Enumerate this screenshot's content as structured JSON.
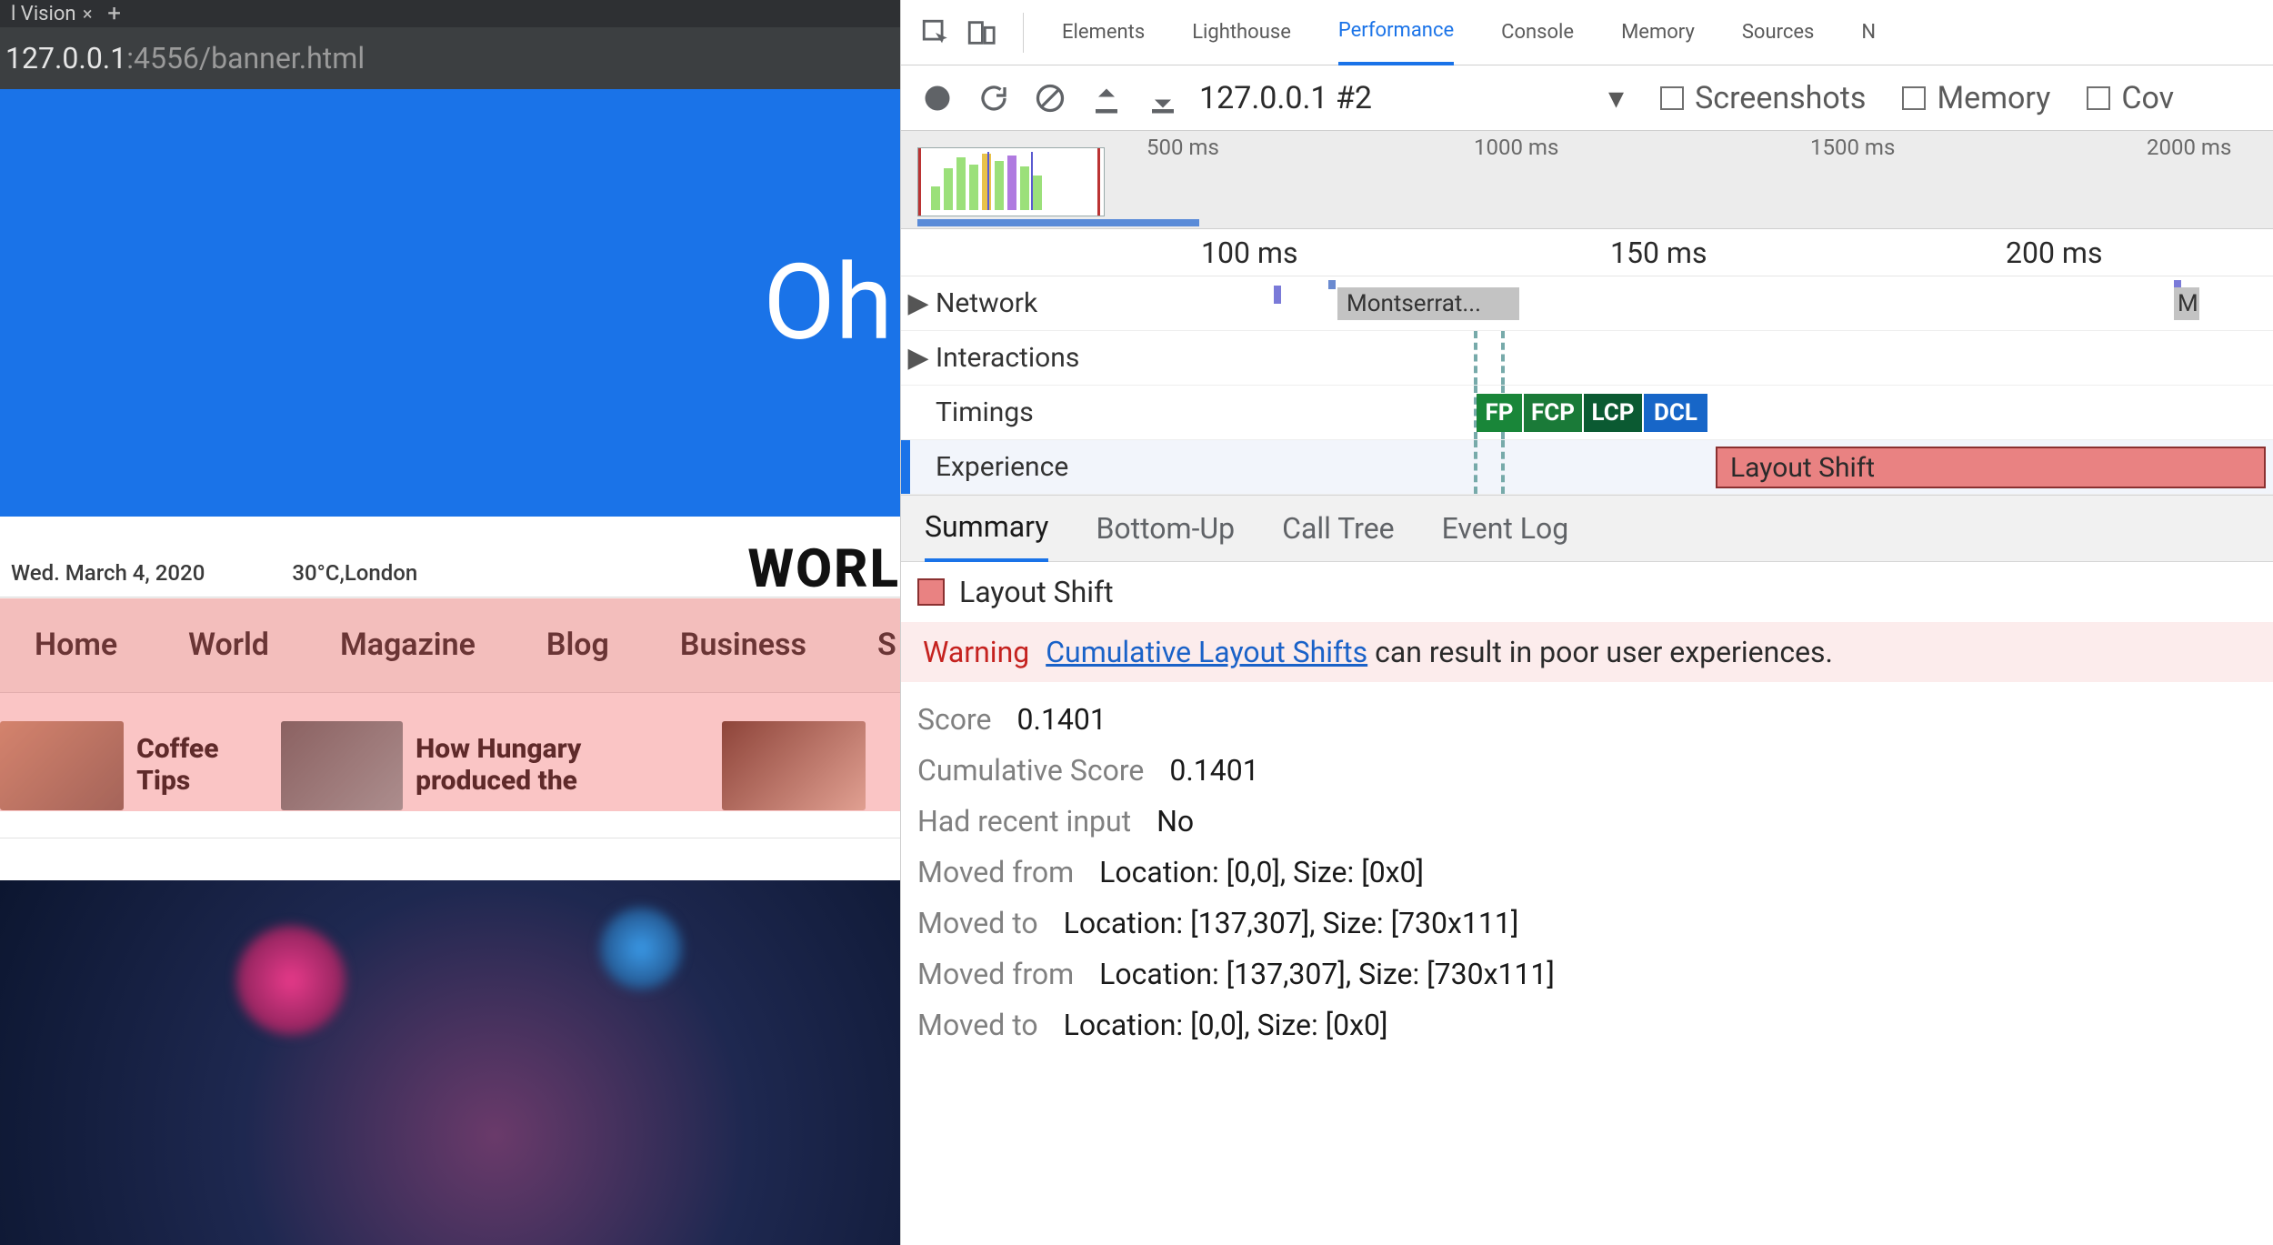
{
  "browser": {
    "tab_title": "l Vision",
    "address_prefix": "127.0.0.1",
    "address_suffix": ":4556/banner.html",
    "hero_text": "Oh",
    "dateline": {
      "date": "Wed. March 4, 2020",
      "weather": "30°C,London"
    },
    "masthead": "WORL",
    "nav": [
      "Home",
      "World",
      "Magazine",
      "Blog",
      "Business",
      "S"
    ],
    "ticker": [
      {
        "title": "Coffee Tips"
      },
      {
        "title": "How Hungary produced the"
      }
    ]
  },
  "devtools": {
    "tabs": [
      "Elements",
      "Lighthouse",
      "Performance",
      "Console",
      "Memory",
      "Sources",
      "N"
    ],
    "active_tab": "Performance",
    "perf": {
      "record_select": "127.0.0.1 #2",
      "checkboxes": [
        "Screenshots",
        "Memory",
        "Cov"
      ],
      "overview_ticks": [
        "500 ms",
        "1000 ms",
        "1500 ms",
        "2000 ms"
      ],
      "fc_ruler": [
        "100 ms",
        "150 ms",
        "200 ms"
      ],
      "rows": {
        "network": "Network",
        "network_item": "Montserrat...",
        "network_tail_marker": "M",
        "interactions": "Interactions",
        "timings": "Timings",
        "timing_markers": [
          "FP",
          "FCP",
          "LCP",
          "DCL"
        ],
        "experience": "Experience",
        "experience_item": "Layout Shift"
      }
    },
    "lower_tabs": [
      "Summary",
      "Bottom-Up",
      "Call Tree",
      "Event Log"
    ],
    "summary": {
      "title": "Layout Shift",
      "warning_label": "Warning",
      "warning_link": "Cumulative Layout Shifts",
      "warning_rest": " can result in poor user experiences.",
      "rows": [
        {
          "k": "Score",
          "v": "0.1401"
        },
        {
          "k": "Cumulative Score",
          "v": "0.1401"
        },
        {
          "k": "Had recent input",
          "v": "No"
        },
        {
          "k": "Moved from",
          "v": "Location: [0,0], Size: [0x0]"
        },
        {
          "k": "Moved to",
          "v": "Location: [137,307], Size: [730x111]"
        },
        {
          "k": "Moved from",
          "v": "Location: [137,307], Size: [730x111]"
        },
        {
          "k": "Moved to",
          "v": "Location: [0,0], Size: [0x0]"
        }
      ]
    }
  }
}
